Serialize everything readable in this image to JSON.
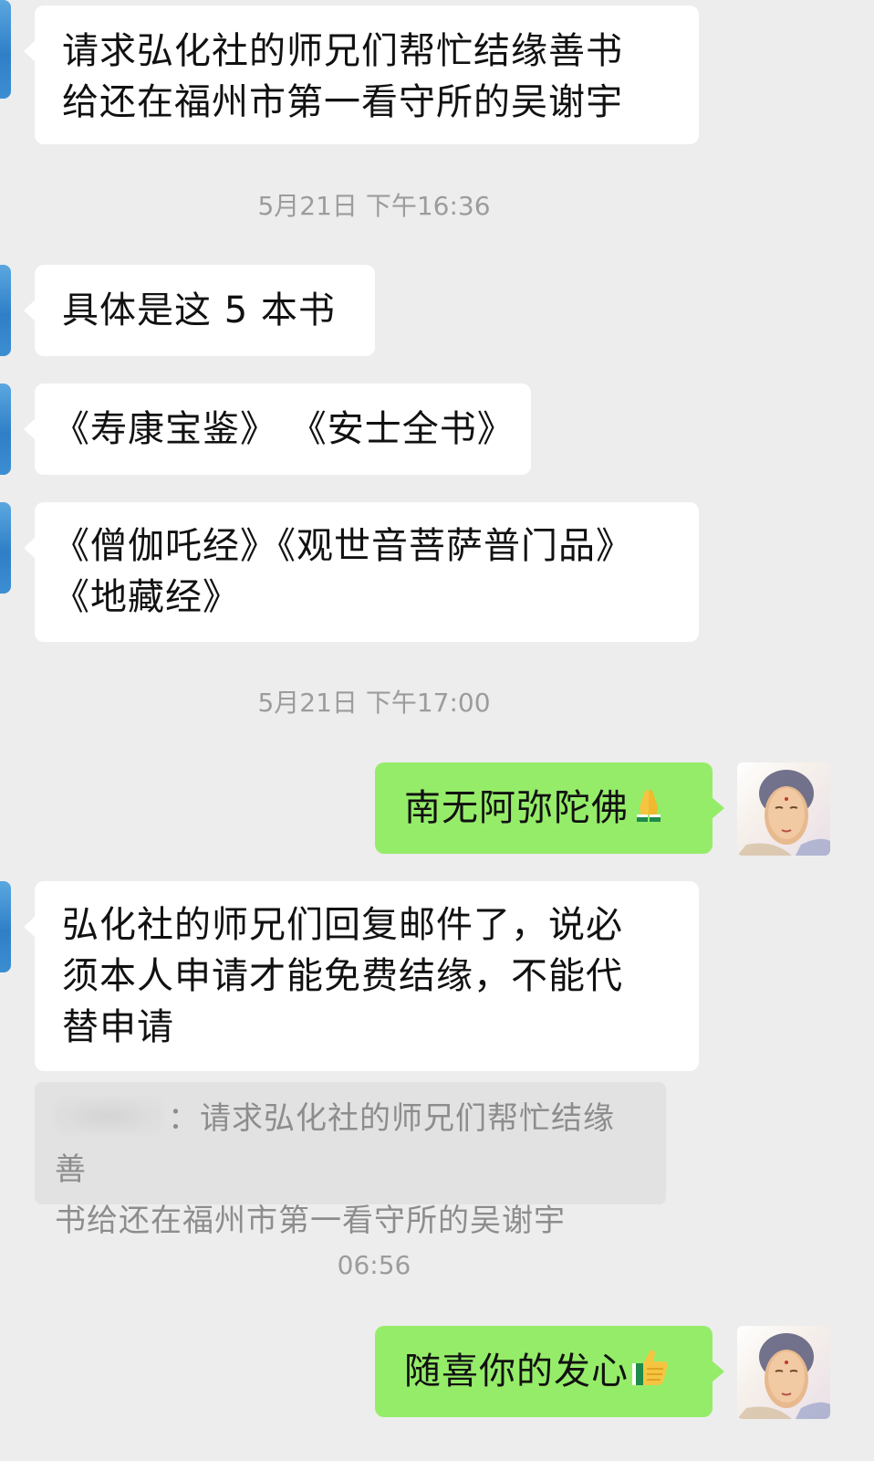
{
  "messages": {
    "m1": "请求弘化社的师兄们帮忙结缘善书\n给还在福州市第一看守所的吴谢宇",
    "m2": "具体是这 5 本书",
    "m3": "《寿康宝鉴》 《安士全书》",
    "m4": "《僧伽吒经》《观世音菩萨普门品》\n《地藏经》",
    "m5": "南无阿弥陀佛",
    "m6": "弘化社的师兄们回复邮件了，说必\n须本人申请才能免费结缘，不能代\n替申请",
    "m7": "随喜你的发心"
  },
  "quote": {
    "text": "：请求弘化社的师兄们帮忙结缘善\n书给还在福州市第一看守所的吴谢宇"
  },
  "timestamps": {
    "t1": "5月21日 下午16:36",
    "t2": "5月21日 下午17:00",
    "t3": "06:56"
  },
  "icons": {
    "m5_emoji": "folded-hands-icon",
    "m7_emoji": "thumbs-up-icon",
    "avatar": "buddha-avatar"
  },
  "colors": {
    "background": "#ededed",
    "incoming_bubble": "#ffffff",
    "outgoing_bubble": "#95ec69",
    "timestamp": "#9c9c9c",
    "quote_bg": "#e2e2e2"
  }
}
